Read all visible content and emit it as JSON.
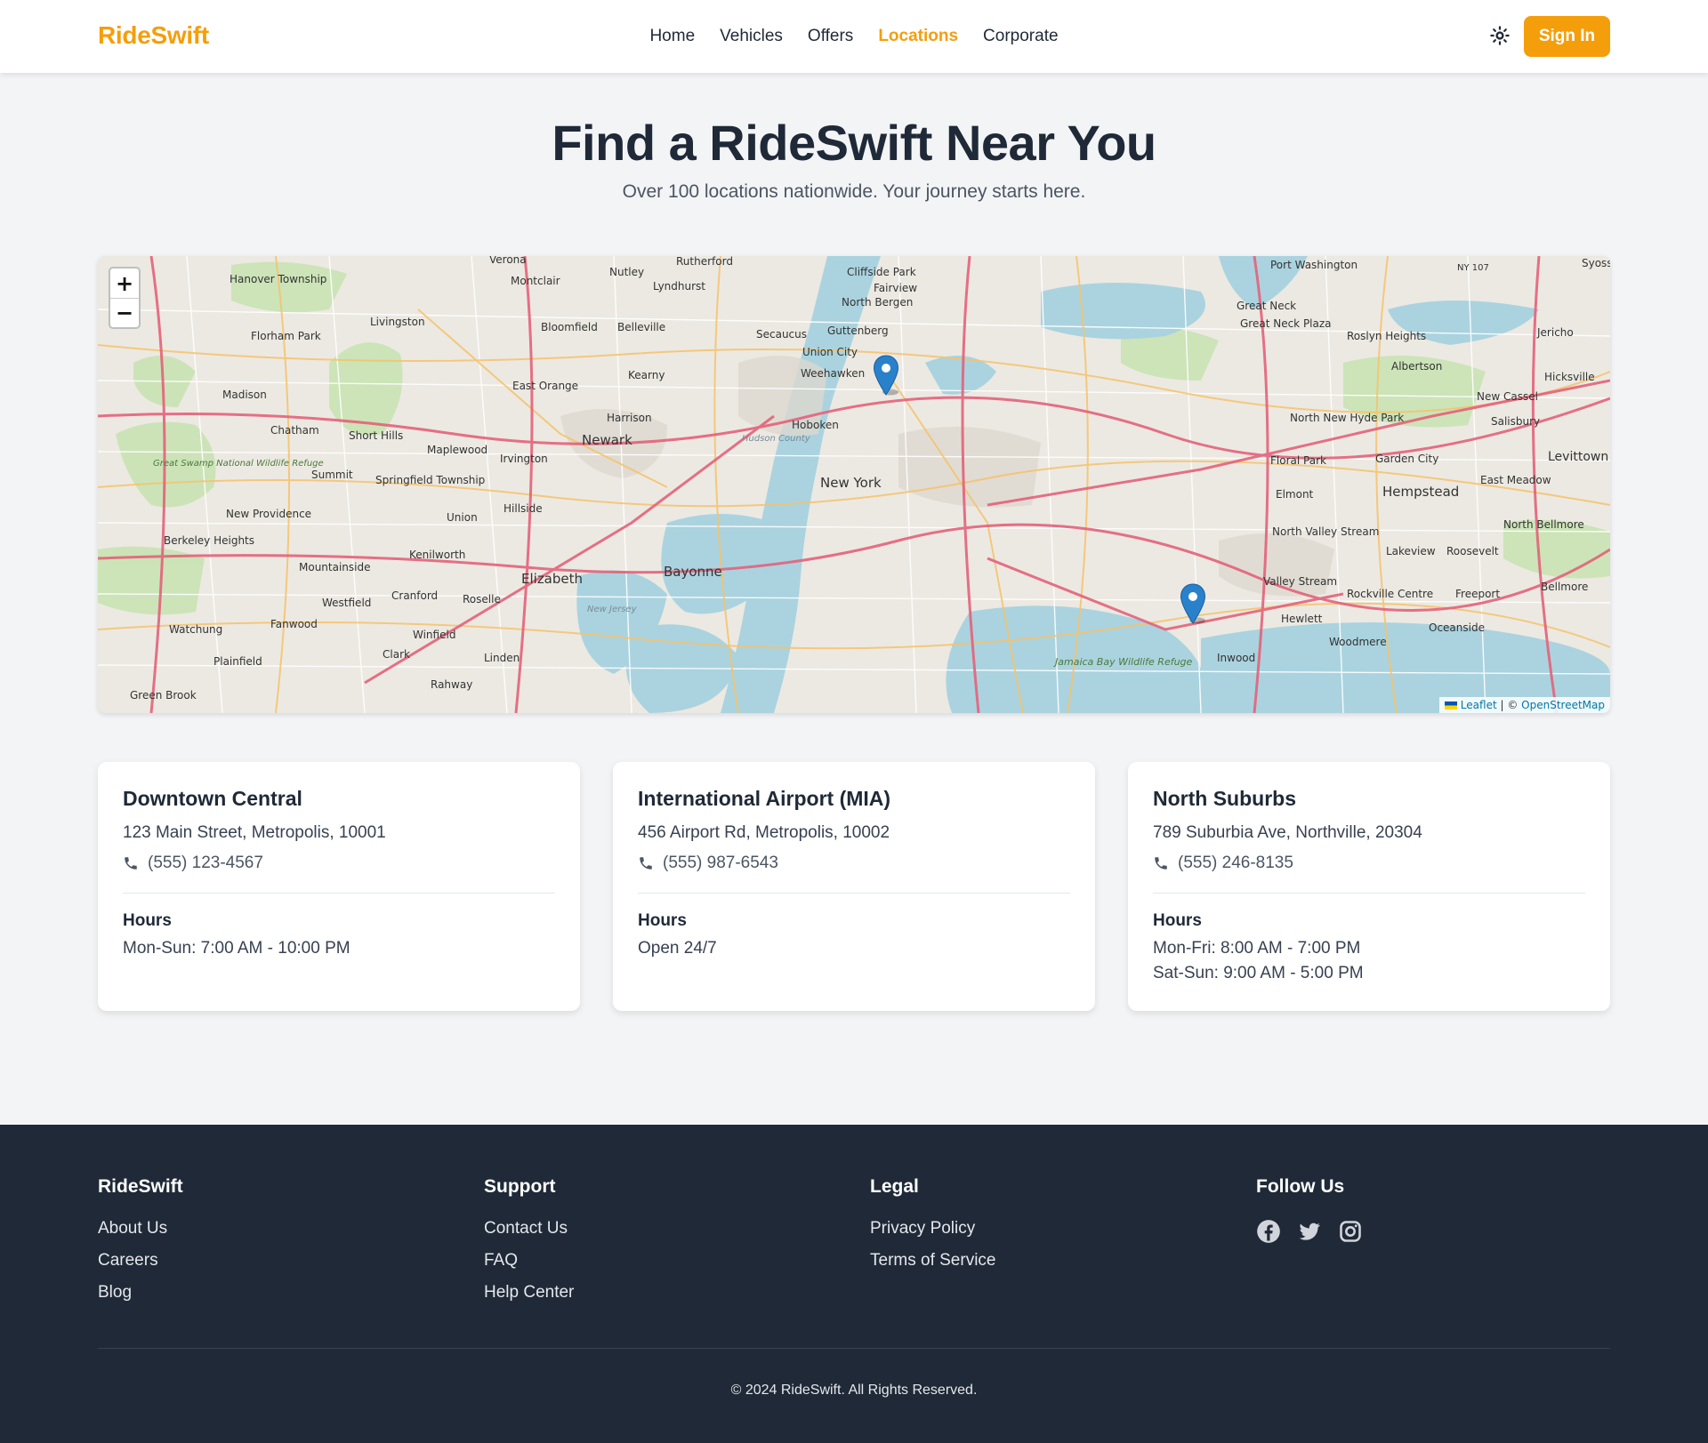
{
  "header": {
    "logo": "RideSwift",
    "nav": [
      "Home",
      "Vehicles",
      "Offers",
      "Locations",
      "Corporate"
    ],
    "active_nav": "Locations",
    "sign_in": "Sign In"
  },
  "hero": {
    "title": "Find a RideSwift Near You",
    "subtitle": "Over 100 locations nationwide. Your journey starts here."
  },
  "map": {
    "zoom_in": "+",
    "zoom_out": "−",
    "attribution_leaflet": "Leaflet",
    "attribution_sep": " | © ",
    "attribution_osm": "OpenStreetMap",
    "labels": [
      "Verona",
      "Nutley",
      "Rutherford",
      "Cliffside Park",
      "Port Washington",
      "NY 107",
      "Syoss",
      "Hanover Township",
      "Montclair",
      "Lyndhurst",
      "Fairview",
      "North Bergen",
      "Great Neck",
      "Great Neck Plaza",
      "Roslyn Heights",
      "Albertson",
      "Jericho",
      "Livingston",
      "Bloomfield",
      "Belleville",
      "Secaucus",
      "Guttenberg",
      "Florham Park",
      "Union City",
      "Weehawken",
      "East Orange",
      "Kearny",
      "Madison",
      "Hicksville",
      "New Cassel",
      "Harrison",
      "Hoboken",
      "North New Hyde Park",
      "Salisbury",
      "Chatham",
      "Short Hills",
      "Newark",
      "Maplewood",
      "Irvington",
      "Summit",
      "Levittown",
      "Garden City",
      "Floral Park",
      "Springfield Township",
      "New York",
      "East Meadow",
      "Great Swamp National Wildlife Refuge",
      "New Providence",
      "Hillside",
      "Union",
      "Elmont",
      "Hempstead",
      "Berkeley Heights",
      "North Bellmore",
      "Kenilworth",
      "North Valley Stream",
      "Lakeview",
      "Mountainside",
      "Bayonne",
      "Elizabeth",
      "Roosevelt",
      "Valley Stream",
      "Cranford",
      "Westfield",
      "Roselle",
      "Rockville Centre",
      "Freeport",
      "Bellmore",
      "Fanwood",
      "Hewlett",
      "Watchung",
      "Oceanside",
      "Winfield",
      "Woodmere",
      "Clark",
      "Plainfield",
      "Linden",
      "Inwood",
      "Jamaica Bay Wildlife Refuge",
      "Rahway",
      "Green Brook",
      "Hudson County",
      "New Jersey"
    ],
    "markers": [
      "downtown-central",
      "north-suburbs"
    ]
  },
  "locations": [
    {
      "name": "Downtown Central",
      "address": "123 Main Street, Metropolis, 10001",
      "phone": "(555) 123-4567",
      "hours_label": "Hours",
      "hours": [
        "Mon-Sun: 7:00 AM - 10:00 PM"
      ]
    },
    {
      "name": "International Airport (MIA)",
      "address": "456 Airport Rd, Metropolis, 10002",
      "phone": "(555) 987-6543",
      "hours_label": "Hours",
      "hours": [
        "Open 24/7"
      ]
    },
    {
      "name": "North Suburbs",
      "address": "789 Suburbia Ave, Northville, 20304",
      "phone": "(555) 246-8135",
      "hours_label": "Hours",
      "hours": [
        "Mon-Fri: 8:00 AM - 7:00 PM",
        "Sat-Sun: 9:00 AM - 5:00 PM"
      ]
    }
  ],
  "footer": {
    "col1": {
      "title": "RideSwift",
      "links": [
        "About Us",
        "Careers",
        "Blog"
      ]
    },
    "col2": {
      "title": "Support",
      "links": [
        "Contact Us",
        "FAQ",
        "Help Center"
      ]
    },
    "col3": {
      "title": "Legal",
      "links": [
        "Privacy Policy",
        "Terms of Service"
      ]
    },
    "col4": {
      "title": "Follow Us",
      "icons": [
        "facebook-icon",
        "twitter-icon",
        "instagram-icon"
      ]
    },
    "copyright": "© 2024 RideSwift. All Rights Reserved."
  },
  "colors": {
    "accent": "#f59e0b",
    "text": "#1f2937",
    "footer_bg": "#1f2937",
    "page_bg": "#f3f4f6",
    "marker": "#2a81cb"
  }
}
